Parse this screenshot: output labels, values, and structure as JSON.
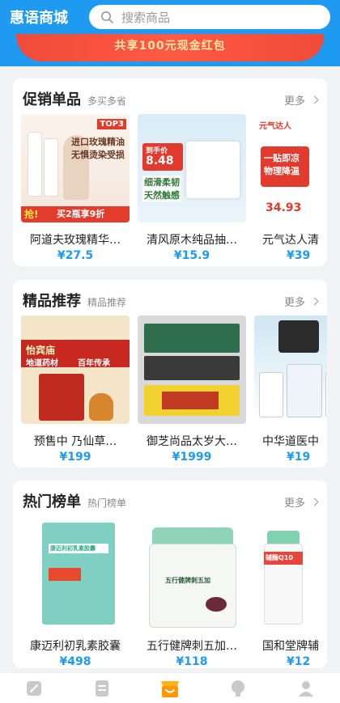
{
  "header": {
    "brand": "惠语商城",
    "search_placeholder": "搜索商品"
  },
  "banner": {
    "text": "共享100元现金红包"
  },
  "sections": [
    {
      "title": "促销单品",
      "subtitle": "多买多省",
      "more": "更多",
      "items": [
        {
          "name": "阿道夫玫瑰精华…",
          "price": "¥27.5",
          "art": {
            "badge": "TOP3",
            "line1": "进口玫瑰精油",
            "line2": "无惧烫染受损",
            "promo": "买2瓶享9折",
            "grab": "抢!"
          }
        },
        {
          "name": "清风原木纯品抽…",
          "price": "¥15.9",
          "art": {
            "tag": "到手价",
            "price": "8.48",
            "line1": "细滑柔韧",
            "line2": "天然触感"
          }
        },
        {
          "name": "元气达人清",
          "price": "¥39",
          "art": {
            "brand": "元气达人",
            "line1": "一贴即凉",
            "line2": "物理降温",
            "price": "34.93"
          }
        }
      ]
    },
    {
      "title": "精品推荐",
      "subtitle": "精品推荐",
      "more": "更多",
      "items": [
        {
          "name": "预售中 乃仙草…",
          "price": "¥199",
          "art": {
            "line1": "怡宾庙",
            "line2": "地道药材",
            "line3": "百年传承"
          }
        },
        {
          "name": "御芝尚品太岁大…",
          "price": "¥1999",
          "art": {}
        },
        {
          "name": "中华道医中",
          "price": "¥19",
          "art": {}
        }
      ]
    },
    {
      "title": "热门榜单",
      "subtitle": "热门榜单",
      "more": "更多",
      "items": [
        {
          "name": "康迈利初乳素胶囊",
          "price": "¥498",
          "art": {
            "label": "康迈利初乳素胶囊"
          }
        },
        {
          "name": "五行健牌刺五加…",
          "price": "¥118",
          "art": {
            "label": "五行健牌刺五加"
          }
        },
        {
          "name": "国和堂牌辅",
          "price": "¥12",
          "art": {
            "label": "辅酶Q10"
          }
        }
      ]
    }
  ],
  "tabbar": [
    "edit-icon",
    "list-icon",
    "shop-icon",
    "bulb-icon",
    "user-icon"
  ]
}
